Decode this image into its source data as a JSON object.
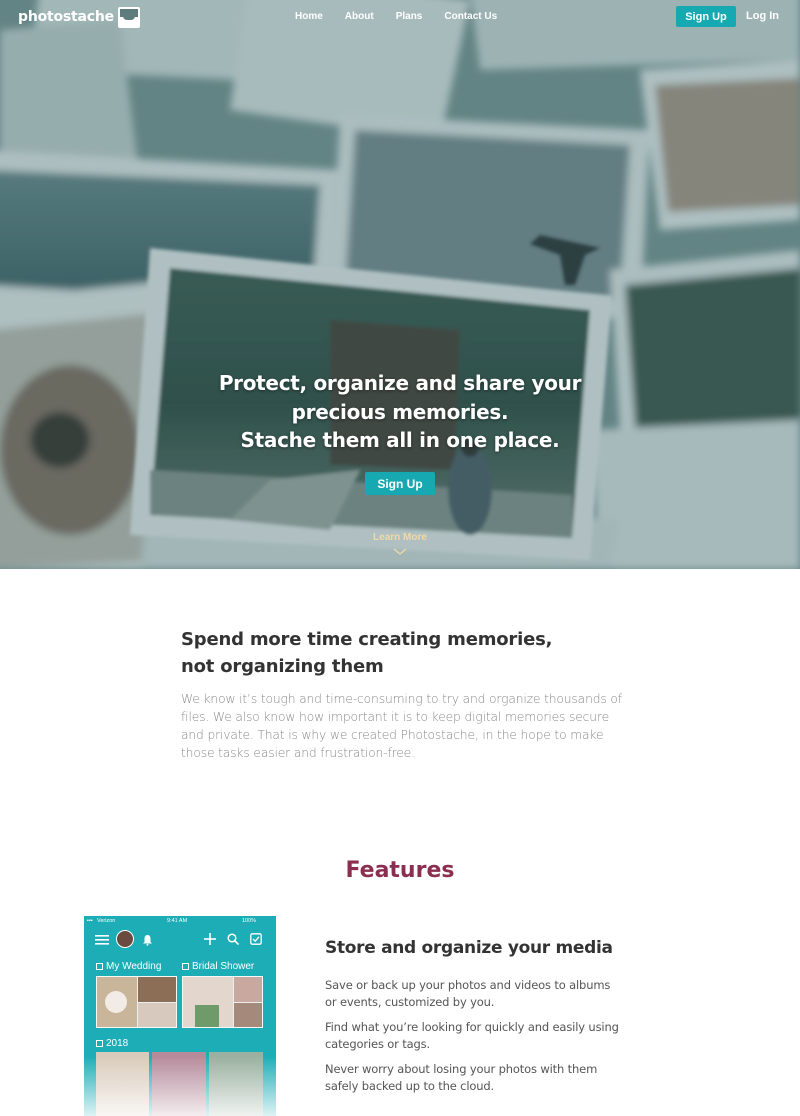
{
  "nav": {
    "logo_text": "photostache",
    "links": [
      "Home",
      "About",
      "Plans",
      "Contact Us"
    ],
    "signup": "Sign Up",
    "login": "Log In"
  },
  "hero": {
    "line1": "Protect, organize and share your",
    "line2": "precious memories.",
    "line3": "Stache them all in one place.",
    "signup": "Sign Up",
    "learn_more": "Learn More"
  },
  "intro": {
    "title_line1": "Spend more time creating memories,",
    "title_line2": "not organizing them",
    "body": "We know it’s tough and time-consuming to try and organize thousands of files. We also know how important it is to keep digital memories secure and private. That is why we created Photostache, in the hope to make those tasks easier and frustration-free."
  },
  "features": {
    "title": "Features",
    "phone": {
      "carrier": "Verizon",
      "time": "9:41 AM",
      "battery": "100%",
      "albums": [
        "My Wedding",
        "Bridal Shower",
        "2018"
      ]
    },
    "store": {
      "title": "Store and organize your media",
      "p1": "Save or back up your photos and videos to albums or events, customized by you.",
      "p2": "Find what you’re looking for quickly and easily using categories or tags.",
      "p3": "Never worry about losing your photos with them safely backed up to the cloud."
    }
  },
  "colors": {
    "accent": "#17a9b1",
    "features_title": "#8b2e4f",
    "learn_more": "#f1d9a4",
    "phone_bg": "#1dadb6"
  }
}
